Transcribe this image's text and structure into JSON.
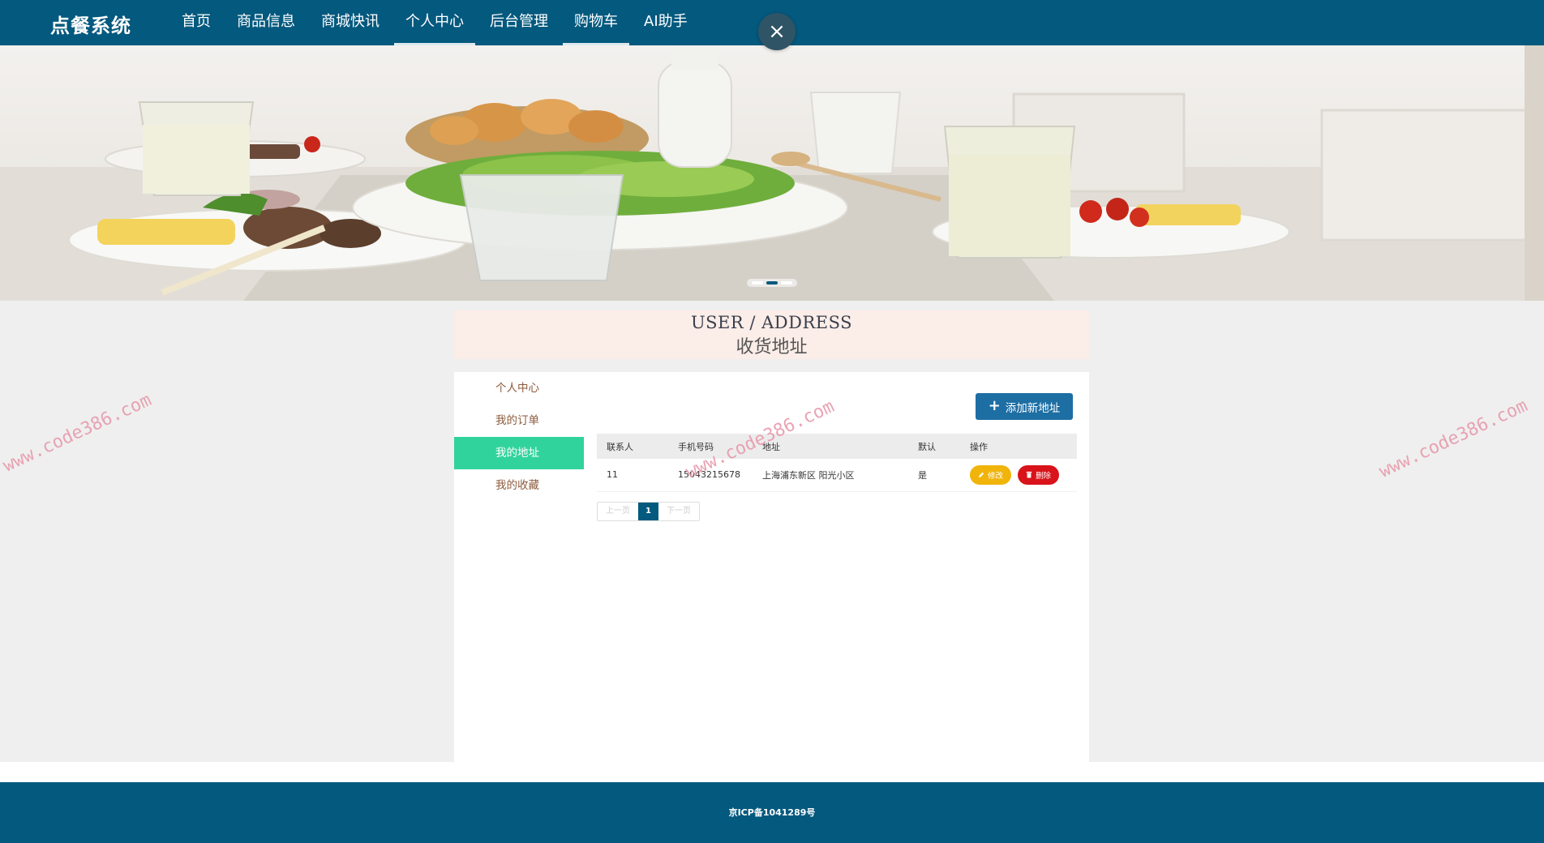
{
  "header": {
    "brand": "点餐系统",
    "nav": [
      {
        "label": "首页"
      },
      {
        "label": "商品信息"
      },
      {
        "label": "商城快讯"
      },
      {
        "label": "个人中心"
      },
      {
        "label": "后台管理"
      },
      {
        "label": "购物车"
      },
      {
        "label": "AI助手"
      }
    ],
    "close_icon": "×"
  },
  "watermark": "www.code386.com",
  "page": {
    "title_en": "USER / ADDRESS",
    "title_cn": "收货地址"
  },
  "sidebar": {
    "items": [
      {
        "label": "个人中心"
      },
      {
        "label": "我的订单"
      },
      {
        "label": "我的地址"
      },
      {
        "label": "我的收藏"
      }
    ],
    "active_index": 2
  },
  "actions": {
    "add_label": "添加新地址"
  },
  "table": {
    "columns": [
      "联系人",
      "手机号码",
      "地址",
      "默认",
      "操作"
    ],
    "rows": [
      {
        "contact": "11",
        "phone": "15043215678",
        "address": "上海浦东新区 阳光小区",
        "default": "是",
        "edit_label": "修改",
        "delete_label": "删除"
      }
    ]
  },
  "pagination": {
    "prev": "上一页",
    "current": "1",
    "next": "下一页"
  },
  "footer": {
    "icp": "京ICP备1041289号"
  },
  "colors": {
    "primary": "#04597e",
    "active_menu": "#31d39c",
    "edit": "#f1b40b",
    "delete": "#d9131a",
    "title_bg": "#fbede8"
  }
}
